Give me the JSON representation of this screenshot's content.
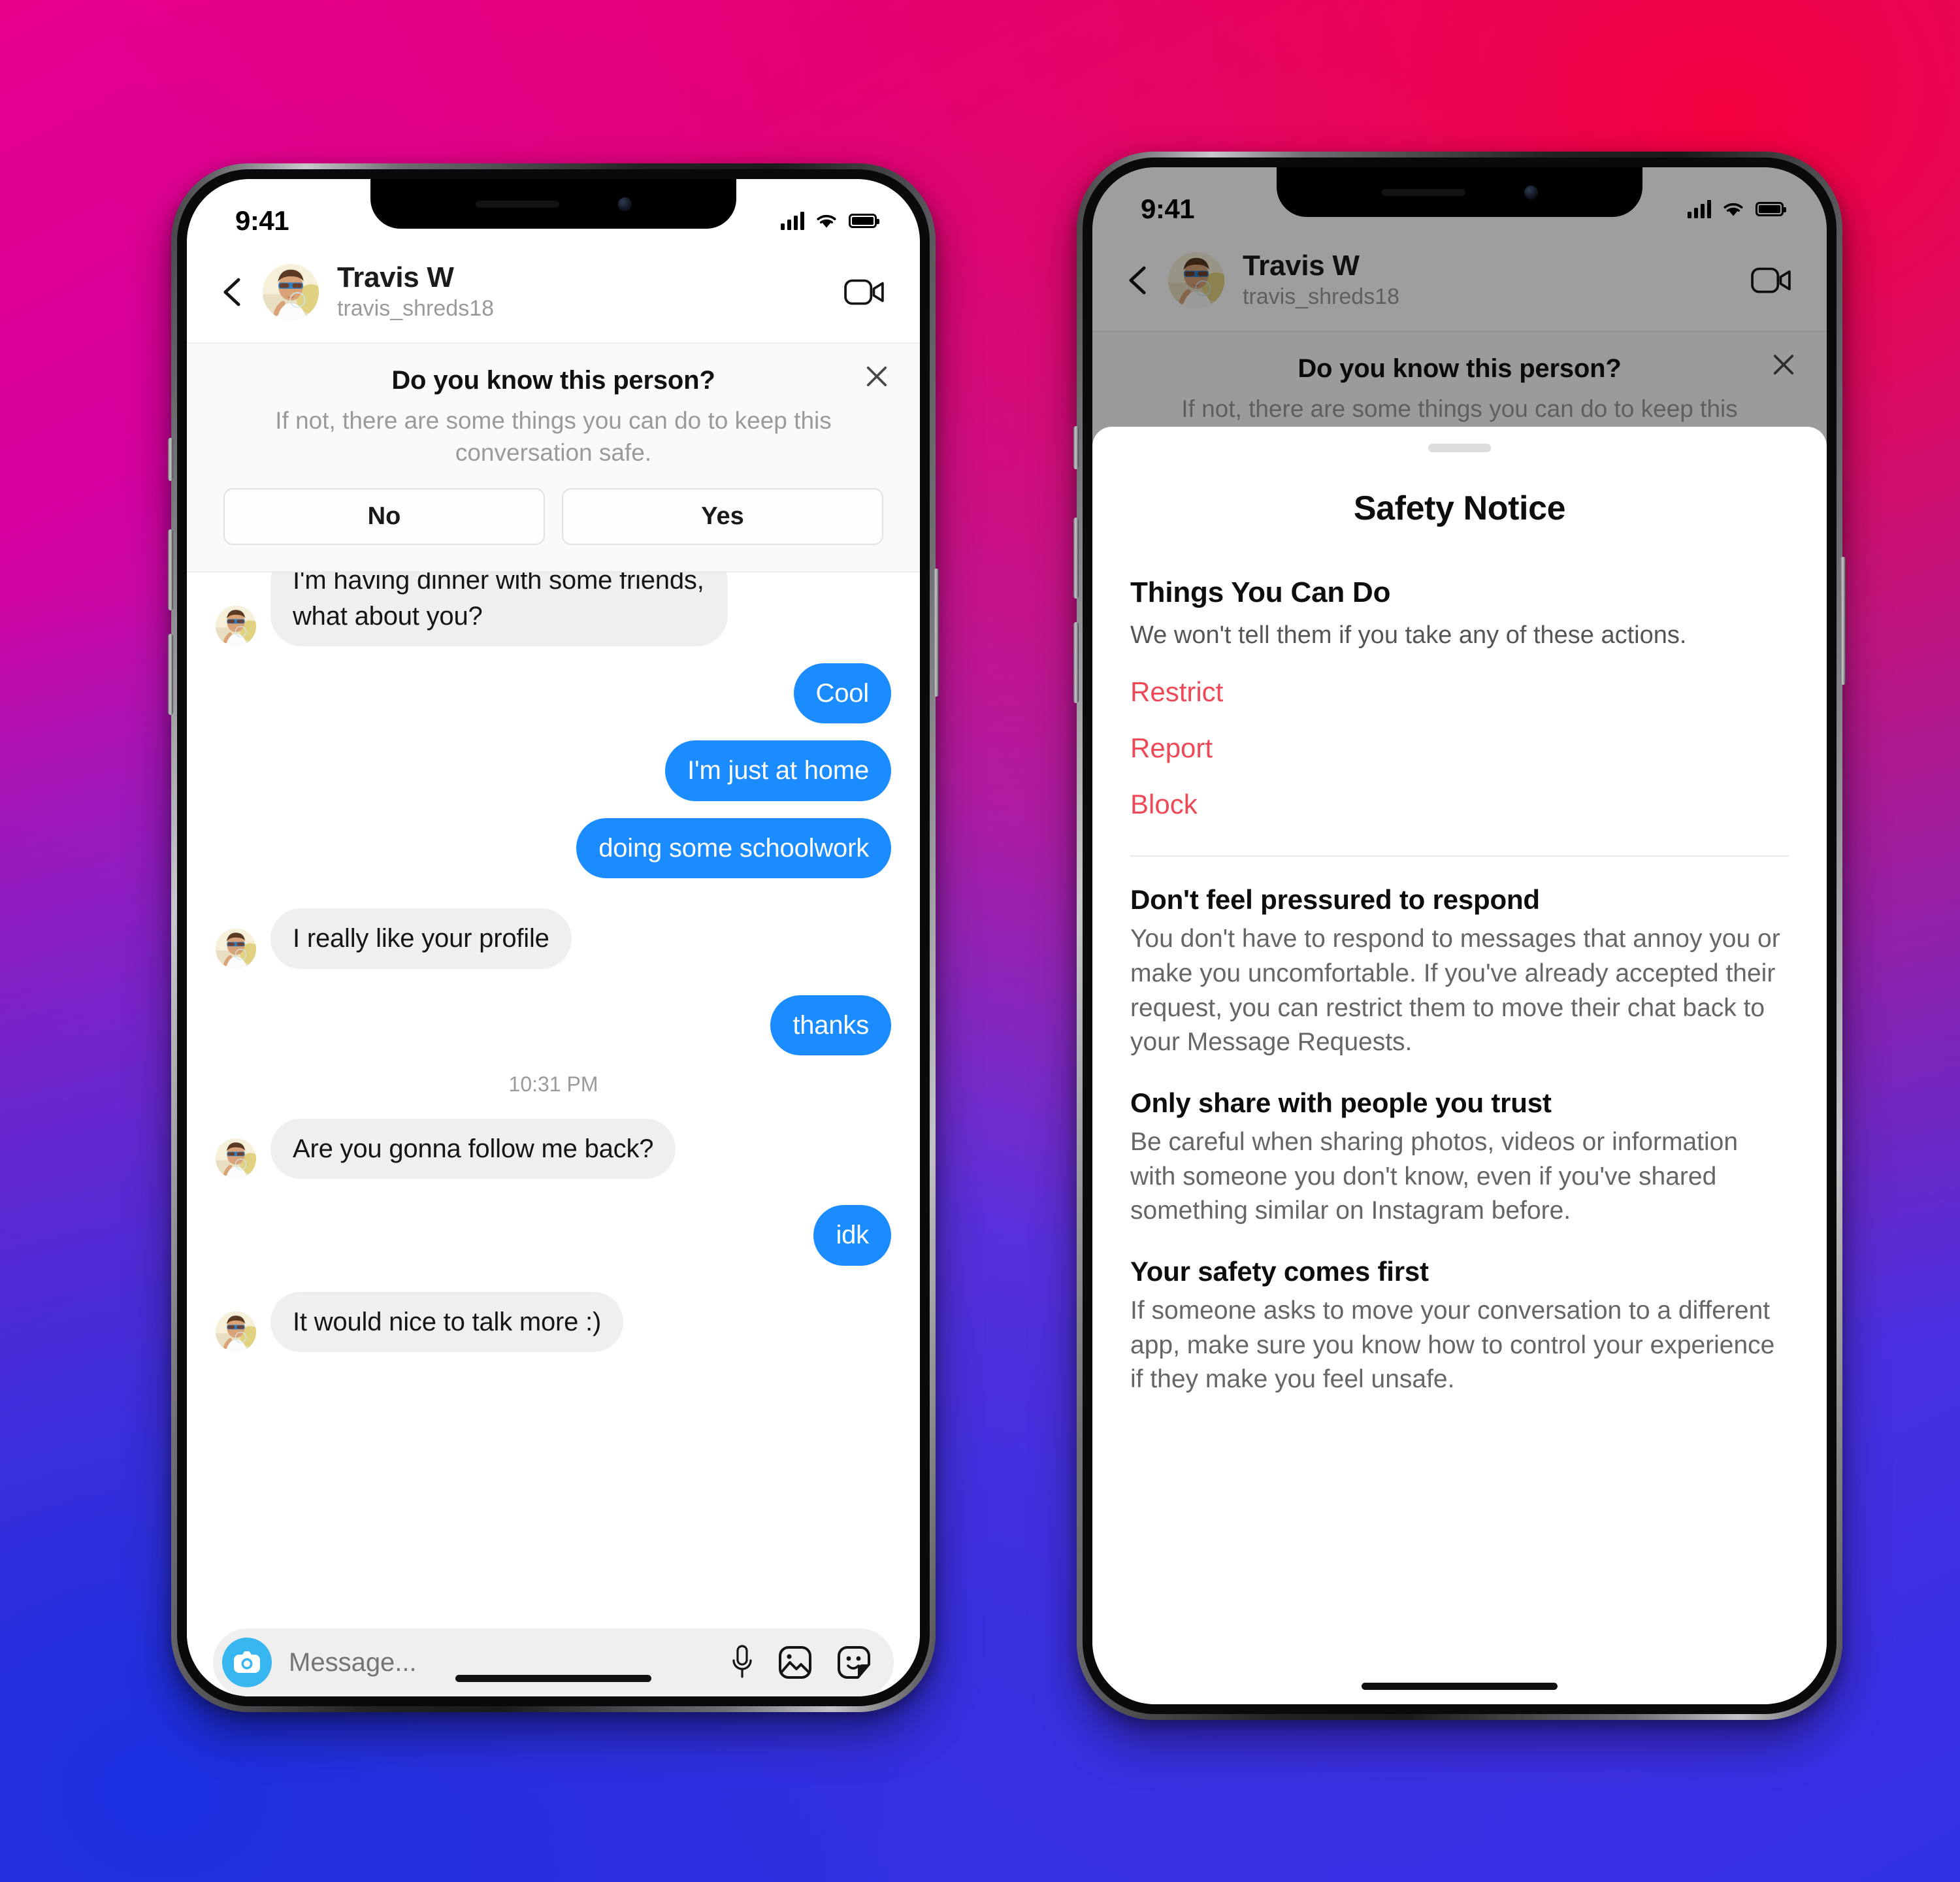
{
  "status_bar": {
    "time": "9:41"
  },
  "chat_header": {
    "name": "Travis W",
    "username": "travis_shreds18",
    "back_icon": "chevron-left-icon",
    "video_icon": "video-camera-icon"
  },
  "know_person_banner": {
    "title": "Do you know this person?",
    "subtitle": "If not, there are some things you can do to keep this conversation safe.",
    "close_icon": "close-icon",
    "buttons": {
      "no": "No",
      "yes": "Yes"
    }
  },
  "conversation": {
    "messages": [
      {
        "from": "them",
        "text": "I'm having dinner with some friends, what about you?"
      },
      {
        "from": "me",
        "text": "Cool"
      },
      {
        "from": "me",
        "text": "I'm just at home"
      },
      {
        "from": "me",
        "text": "doing some schoolwork"
      },
      {
        "from": "them",
        "text": "I really like your profile"
      },
      {
        "from": "me",
        "text": "thanks"
      },
      {
        "from": "them",
        "text": "Are you gonna follow me back?"
      },
      {
        "from": "me",
        "text": "idk"
      },
      {
        "from": "them",
        "text": "It would nice to talk more :)"
      }
    ],
    "timestamp": "10:31 PM"
  },
  "composer": {
    "placeholder": "Message...",
    "value": "",
    "camera_icon": "camera-icon",
    "mic_icon": "microphone-icon",
    "gallery_icon": "photo-icon",
    "sticker_icon": "sticker-icon"
  },
  "safety_sheet": {
    "title": "Safety Notice",
    "section_title": "Things You Can Do",
    "section_subtitle": "We won't tell them if you take any of these actions.",
    "actions": [
      {
        "label": "Restrict"
      },
      {
        "label": "Report"
      },
      {
        "label": "Block"
      }
    ],
    "tips": [
      {
        "heading": "Don't feel pressured to respond",
        "body": "You don't have to respond to messages that annoy you or make you uncomfortable. If you've already accepted their request, you can restrict them to move their chat back to your Message Requests."
      },
      {
        "heading": "Only share with people you trust",
        "body": "Be careful when sharing photos, videos or information with someone you don't know, even if you've shared something similar on Instagram before."
      },
      {
        "heading": "Your safety comes first",
        "body": "If someone asks to move your conversation to a different app, make sure you know how to control your experience if they make you feel unsafe."
      }
    ]
  },
  "colors": {
    "outgoing_bubble": "#1a8cff",
    "incoming_bubble": "#efefef",
    "danger": "#ed4956",
    "camera_accent": "#38b6f0",
    "muted_text": "#9a9a9e"
  }
}
